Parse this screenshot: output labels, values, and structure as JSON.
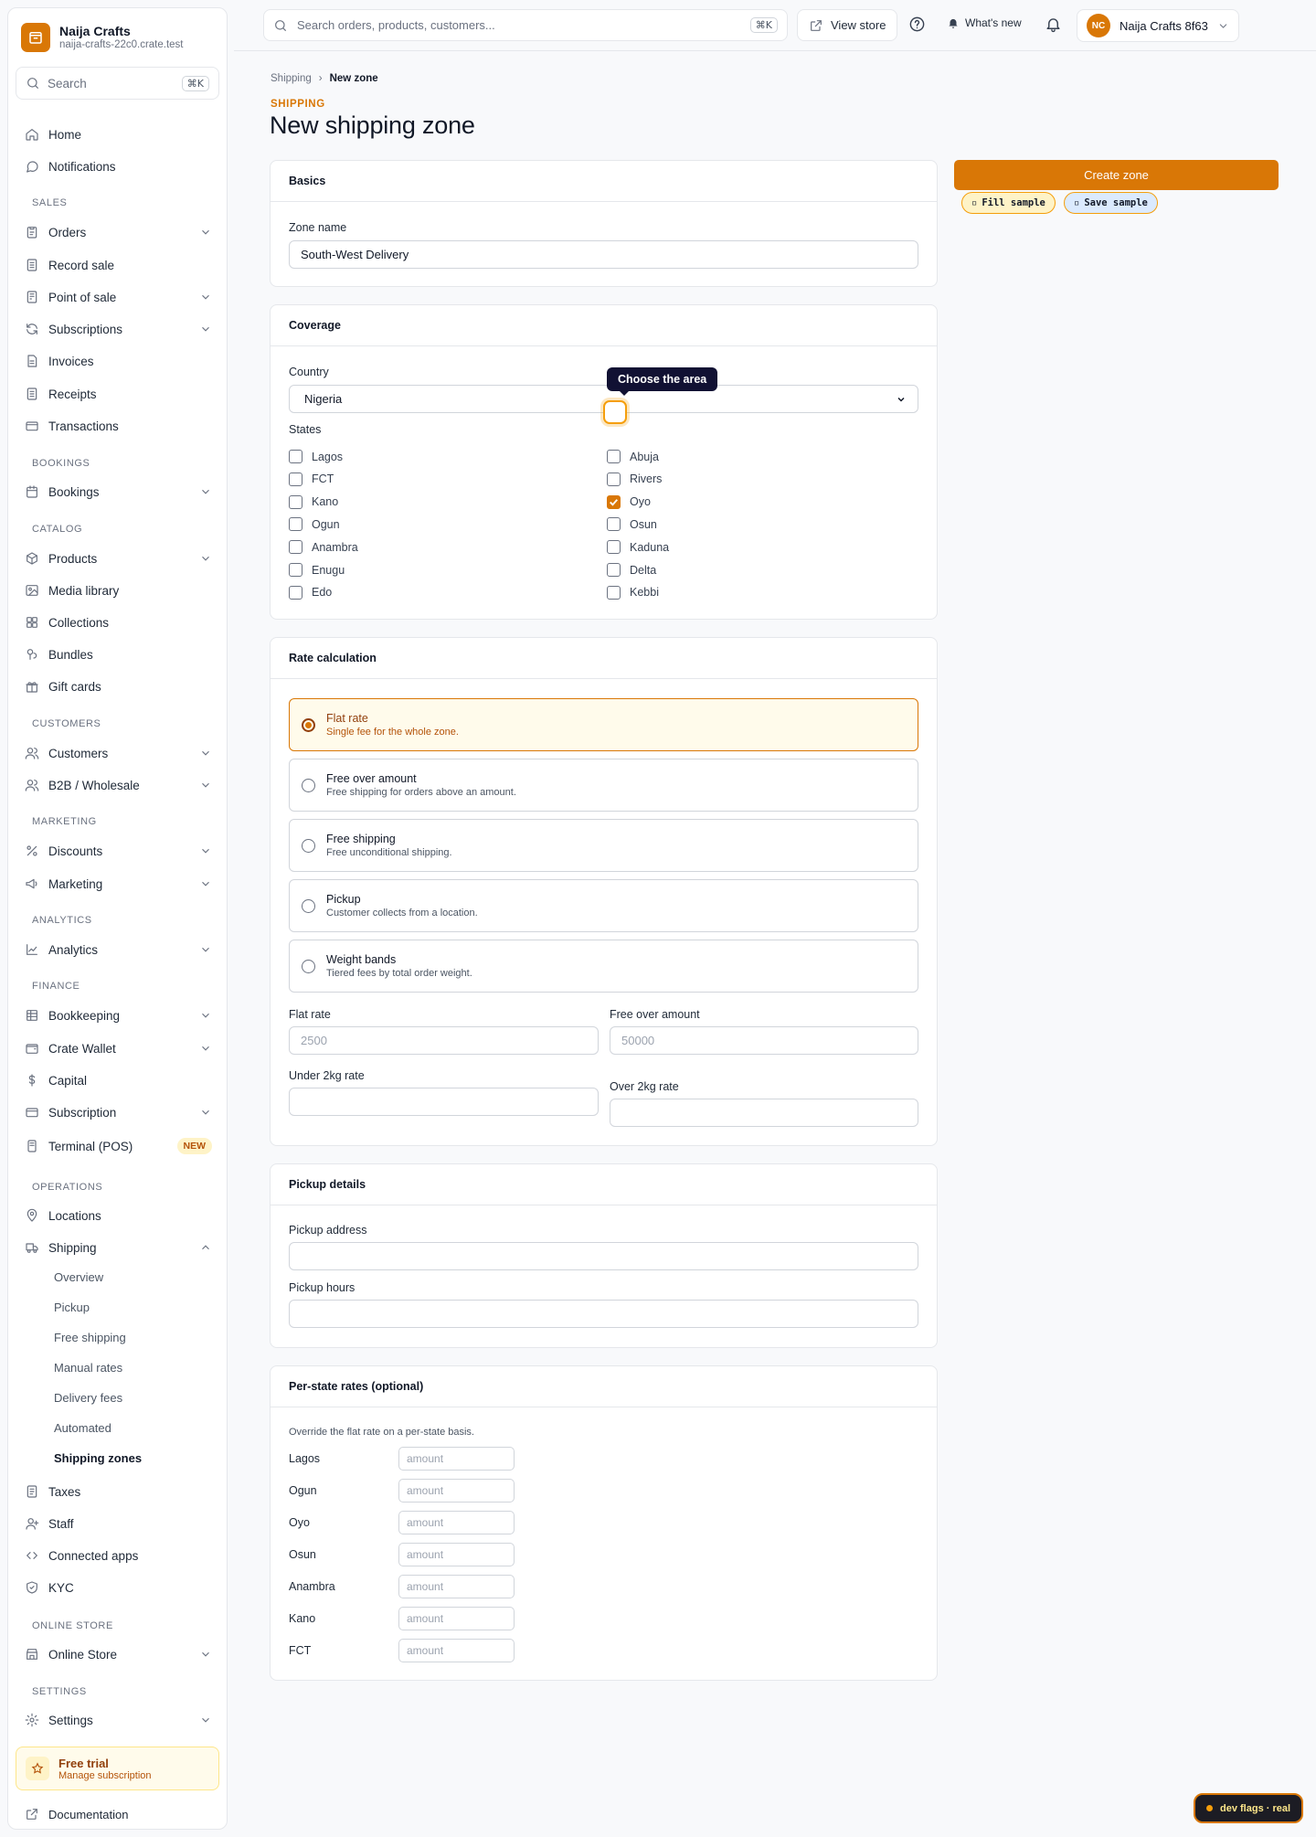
{
  "brand": {
    "name": "Naija Crafts",
    "domain": "naija-crafts-22c0.crate.test"
  },
  "sidebar_search": {
    "placeholder": "Search",
    "shortcut": "⌘K"
  },
  "nav": {
    "home": "Home",
    "notifications": "Notifications",
    "sec_sales": "SALES",
    "orders": "Orders",
    "record_sale": "Record sale",
    "pos": "Point of sale",
    "subscriptions": "Subscriptions",
    "invoices": "Invoices",
    "receipts": "Receipts",
    "transactions": "Transactions",
    "sec_bookings": "BOOKINGS",
    "bookings": "Bookings",
    "sec_catalog": "CATALOG",
    "products": "Products",
    "media": "Media library",
    "collections": "Collections",
    "bundles": "Bundles",
    "gift_cards": "Gift cards",
    "sec_customers": "CUSTOMERS",
    "customers": "Customers",
    "b2b": "B2B / Wholesale",
    "sec_marketing": "MARKETING",
    "discounts": "Discounts",
    "marketing": "Marketing",
    "sec_analytics": "ANALYTICS",
    "analytics": "Analytics",
    "sec_finance": "FINANCE",
    "bookkeeping": "Bookkeeping",
    "wallet": "Crate Wallet",
    "capital": "Capital",
    "subscription": "Subscription",
    "terminal": "Terminal (POS)",
    "terminal_badge": "NEW",
    "sec_operations": "OPERATIONS",
    "locations": "Locations",
    "shipping": "Shipping",
    "ship_overview": "Overview",
    "ship_pickup": "Pickup",
    "ship_free": "Free shipping",
    "ship_manual": "Manual rates",
    "ship_fees": "Delivery fees",
    "ship_automated": "Automated",
    "ship_zones": "Shipping zones",
    "taxes": "Taxes",
    "staff": "Staff",
    "connected_apps": "Connected apps",
    "kyc": "KYC",
    "sec_online": "ONLINE STORE",
    "online_store": "Online Store",
    "sec_settings": "SETTINGS",
    "settings": "Settings"
  },
  "trial": {
    "title": "Free trial",
    "subtitle": "Manage subscription"
  },
  "documentation": "Documentation",
  "topbar": {
    "search_placeholder": "Search orders, products, customers...",
    "search_shortcut": "⌘K",
    "view_store": "View store",
    "whats_new": "What's new",
    "account_initials": "NC",
    "account_name": "Naija Crafts 8f63"
  },
  "breadcrumb": {
    "parent": "Shipping",
    "sep": "›",
    "current": "New zone"
  },
  "eyebrow": "SHIPPING",
  "title": "New shipping zone",
  "basics": {
    "heading": "Basics",
    "zone_label": "Zone name",
    "zone_value": "South-West Delivery"
  },
  "coverage": {
    "heading": "Coverage",
    "country_label": "Country",
    "country_value": "Nigeria",
    "states_label": "States",
    "states_left": [
      {
        "name": "Lagos",
        "checked": false
      },
      {
        "name": "FCT",
        "checked": false
      },
      {
        "name": "Kano",
        "checked": false
      },
      {
        "name": "Ogun",
        "checked": false
      },
      {
        "name": "Anambra",
        "checked": false
      },
      {
        "name": "Enugu",
        "checked": false
      },
      {
        "name": "Edo",
        "checked": false
      }
    ],
    "states_right": [
      {
        "name": "Abuja",
        "checked": false
      },
      {
        "name": "Rivers",
        "checked": false
      },
      {
        "name": "Oyo",
        "checked": true
      },
      {
        "name": "Osun",
        "checked": false
      },
      {
        "name": "Kaduna",
        "checked": false
      },
      {
        "name": "Delta",
        "checked": false
      },
      {
        "name": "Kebbi",
        "checked": false
      }
    ]
  },
  "tooltip": "Choose the area",
  "rates": {
    "heading": "Rate calculation",
    "options": [
      {
        "title": "Flat rate",
        "subtitle": "Single fee for the whole zone.",
        "selected": true
      },
      {
        "title": "Free over amount",
        "subtitle": "Free shipping for orders above an amount.",
        "selected": false
      },
      {
        "title": "Free shipping",
        "subtitle": "Free unconditional shipping.",
        "selected": false
      },
      {
        "title": "Pickup",
        "subtitle": "Customer collects from a location.",
        "selected": false
      },
      {
        "title": "Weight bands",
        "subtitle": "Tiered fees by total order weight.",
        "selected": false
      }
    ],
    "flat_label": "Flat rate",
    "flat_placeholder": "2500",
    "free_over_label": "Free over amount",
    "free_over_placeholder": "50000",
    "under2_label": "Under 2kg rate",
    "over2_label": "Over 2kg rate"
  },
  "pickup": {
    "heading": "Pickup details",
    "address_label": "Pickup address",
    "hours_label": "Pickup hours"
  },
  "per_state": {
    "heading": "Per-state rates (optional)",
    "description": "Override the flat rate on a per-state basis.",
    "placeholder": "amount",
    "states": [
      "Lagos",
      "Ogun",
      "Oyo",
      "Osun",
      "Anambra",
      "Kano",
      "FCT"
    ]
  },
  "actions": {
    "create": "Create zone",
    "fill_sample": "Fill sample",
    "save_sample": "Save sample"
  },
  "devflags": "dev flags · real",
  "colors": {
    "accent": "#d97706",
    "accent_light": "#fffbeb",
    "tooltip_bg": "#111133"
  }
}
